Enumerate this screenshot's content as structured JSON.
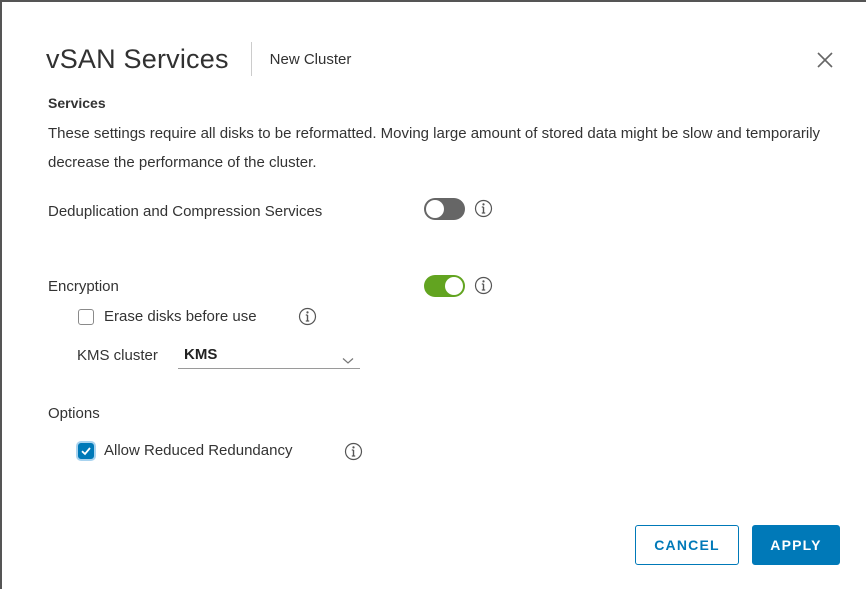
{
  "dialog": {
    "title": "vSAN Services",
    "subtitle": "New Cluster",
    "close_icon": "close-icon"
  },
  "services": {
    "section_label": "Services",
    "description": "These settings require all disks to be reformatted. Moving large amount of stored data might be slow and temporarily decrease the performance of the cluster."
  },
  "dedup": {
    "label": "Deduplication and Compression Services",
    "enabled": false,
    "info_icon": "info-icon"
  },
  "encryption": {
    "label": "Encryption",
    "enabled": true,
    "info_icon": "info-icon",
    "erase_label": "Erase disks before use",
    "erase_checked": false,
    "kms_label": "KMS cluster",
    "kms_value": "KMS"
  },
  "options": {
    "label": "Options",
    "reduced_redundancy_label": "Allow Reduced Redundancy",
    "reduced_redundancy_checked": true
  },
  "buttons": {
    "cancel": "CANCEL",
    "apply": "APPLY"
  },
  "colors": {
    "accent": "#0079b8",
    "toggle_on": "#62a420",
    "toggle_off": "#666666"
  }
}
